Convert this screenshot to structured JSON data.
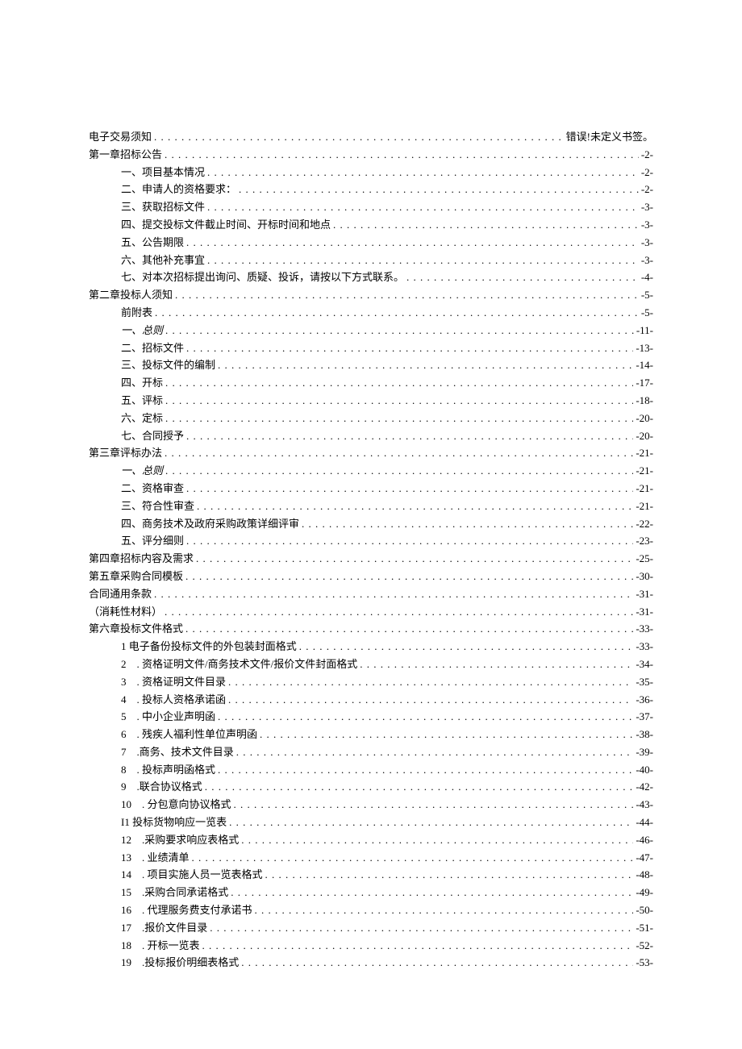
{
  "toc": [
    {
      "level": 0,
      "label": "电子交易须知",
      "page": "错误!未定义书签。",
      "italic": false,
      "error": true
    },
    {
      "level": 0,
      "label": "第一章招标公告",
      "page": "-2-",
      "italic": false
    },
    {
      "level": 1,
      "label": "一、项目基本情况",
      "page": "-2-",
      "italic": false
    },
    {
      "level": 1,
      "label": "二、申请人的资格要求：",
      "page": "-2-",
      "italic": false
    },
    {
      "level": 1,
      "label": "三、获取招标文件",
      "page": "-3-",
      "italic": false
    },
    {
      "level": 1,
      "label": "四、提交投标文件截止时间、开标时间和地点",
      "page": "-3-",
      "italic": false
    },
    {
      "level": 1,
      "label": "五、公告期限",
      "page": "-3-",
      "italic": false
    },
    {
      "level": 1,
      "label": "六、其他补充事宜",
      "page": "-3-",
      "italic": false
    },
    {
      "level": 1,
      "label": "七、对本次招标提出询问、质疑、投诉，请按以下方式联系。",
      "page": "-4-",
      "italic": false
    },
    {
      "level": 0,
      "label": "第二章投标人须知",
      "page": "-5-",
      "italic": false
    },
    {
      "level": 1,
      "label": "前附表",
      "page": "-5-",
      "italic": false
    },
    {
      "level": 1,
      "label": "一、总则",
      "page": "-11-",
      "italic": true
    },
    {
      "level": 1,
      "label": "二、招标文件",
      "page": "-13-",
      "italic": false
    },
    {
      "level": 1,
      "label": "三、投标文件的编制",
      "page": "-14-",
      "italic": false
    },
    {
      "level": 1,
      "label": "四、开标",
      "page": "-17-",
      "italic": false
    },
    {
      "level": 1,
      "label": "五、评标",
      "page": "-18-",
      "italic": false
    },
    {
      "level": 1,
      "label": "六、定标",
      "page": "-20-",
      "italic": false
    },
    {
      "level": 1,
      "label": "七、合同授予",
      "page": "-20-",
      "italic": false
    },
    {
      "level": 0,
      "label": "第三章评标办法",
      "page": "-21-",
      "italic": false
    },
    {
      "level": 1,
      "label": "一、总则",
      "page": "-21-",
      "italic": true
    },
    {
      "level": 1,
      "label": "二、资格审查",
      "page": "-21-",
      "italic": false
    },
    {
      "level": 1,
      "label": "三、符合性审查",
      "page": "-21-",
      "italic": false
    },
    {
      "level": 1,
      "label": "四、商务技术及政府采购政策详细评审",
      "page": "-22-",
      "italic": false
    },
    {
      "level": 1,
      "label": "五、评分细则",
      "page": "-23-",
      "italic": false
    },
    {
      "level": 0,
      "label": "第四章招标内容及需求",
      "page": "-25-",
      "italic": false
    },
    {
      "level": 0,
      "label": "第五章采购合同模板",
      "page": "-30-",
      "italic": false
    },
    {
      "level": 0,
      "label": "合同通用条款",
      "page": "-31-",
      "italic": false
    },
    {
      "level": 0,
      "label": "（消耗性材料）",
      "page": "-31-",
      "italic": false
    },
    {
      "level": 0,
      "label": "第六章投标文件格式",
      "page": "-33-",
      "italic": false
    },
    {
      "level": 1,
      "label": "1 电子备份投标文件的外包装封面格式",
      "page": "-33-",
      "italic": false
    },
    {
      "level": 1,
      "label": "2　. 资格证明文件/商务技术文件/报价文件封面格式",
      "page": "-34-",
      "italic": false
    },
    {
      "level": 1,
      "label": "3　. 资格证明文件目录",
      "page": "-35-",
      "italic": false
    },
    {
      "level": 1,
      "label": "4　. 投标人资格承诺函",
      "page": "-36-",
      "italic": false
    },
    {
      "level": 1,
      "label": "5　. 中小企业声明函",
      "page": "-37-",
      "italic": false
    },
    {
      "level": 1,
      "label": "6　. 残疾人福利性单位声明函",
      "page": "-38-",
      "italic": false
    },
    {
      "level": 1,
      "label": "7　.商务、技术文件目录",
      "page": "-39-",
      "italic": false
    },
    {
      "level": 1,
      "label": "8　. 投标声明函格式",
      "page": "-40-",
      "italic": false
    },
    {
      "level": 1,
      "label": "9　.联合协议格式",
      "page": "-42-",
      "italic": false
    },
    {
      "level": 1,
      "label": "10　. 分包意向协议格式",
      "page": "-43-",
      "italic": false
    },
    {
      "level": 1,
      "label": "I1 投标货物响应一览表",
      "page": "-44-",
      "italic": false
    },
    {
      "level": 1,
      "label": "12　.采购要求响应表格式",
      "page": "-46-",
      "italic": false
    },
    {
      "level": 1,
      "label": "13　. 业绩清单",
      "page": "-47-",
      "italic": false
    },
    {
      "level": 1,
      "label": "14　. 项目实施人员一览表格式",
      "page": "-48-",
      "italic": false
    },
    {
      "level": 1,
      "label": "15　.采购合同承诺格式",
      "page": "-49-",
      "italic": false
    },
    {
      "level": 1,
      "label": "16　. 代理服务费支付承诺书",
      "page": "-50-",
      "italic": false
    },
    {
      "level": 1,
      "label": "17　.报价文件目录",
      "page": "-51-",
      "italic": false
    },
    {
      "level": 1,
      "label": "18　. 开标一览表",
      "page": "-52-",
      "italic": false
    },
    {
      "level": 1,
      "label": "19　.投标报价明细表格式",
      "page": "-53-",
      "italic": false
    }
  ]
}
